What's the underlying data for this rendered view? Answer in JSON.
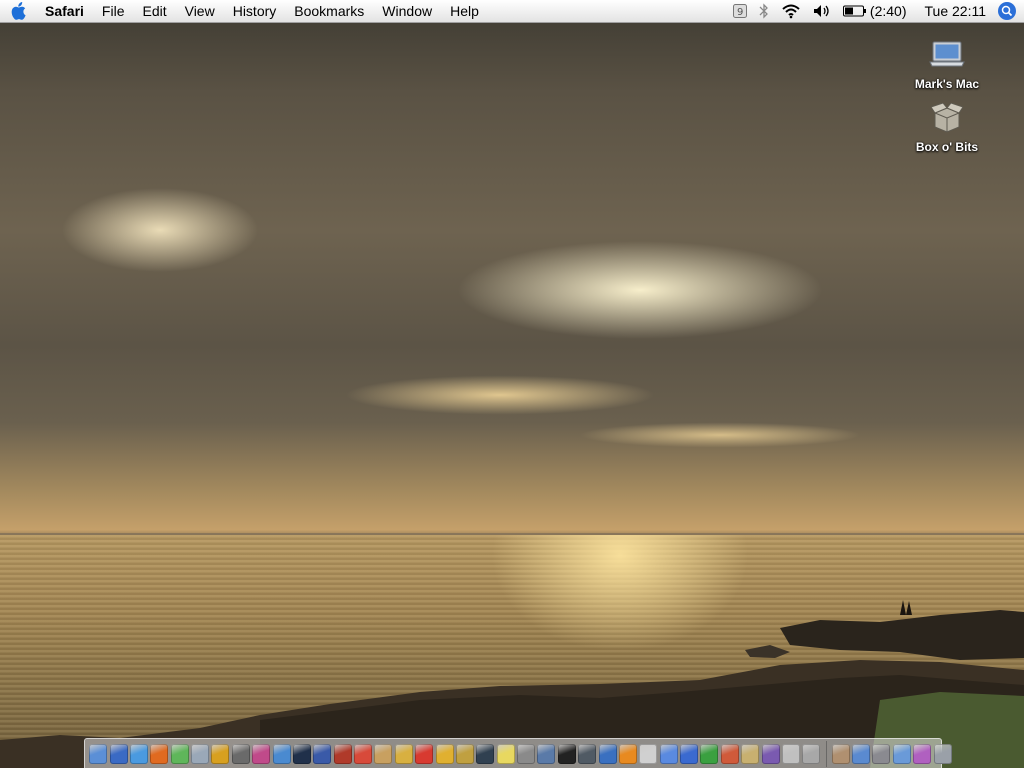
{
  "menubar": {
    "apple_icon": "apple-icon",
    "app_name": "Safari",
    "menus": [
      "File",
      "Edit",
      "View",
      "History",
      "Bookmarks",
      "Window",
      "Help"
    ],
    "status": {
      "battery_time": "(2:40)",
      "clock": "Tue 22:11"
    }
  },
  "desktop": {
    "icons": [
      {
        "label": "Mark's Mac",
        "icon": "laptop-icon"
      },
      {
        "label": "Box o' Bits",
        "icon": "box-icon"
      }
    ]
  },
  "dock": {
    "apps": [
      {
        "icon": "finder-icon",
        "color": "#5b8fd6"
      },
      {
        "icon": "dashboard-icon",
        "color": "#3a6ac4"
      },
      {
        "icon": "safari-icon",
        "color": "#4a9ae0"
      },
      {
        "icon": "firefox-icon",
        "color": "#e06a20"
      },
      {
        "icon": "itunes-icon",
        "color": "#5fb65a"
      },
      {
        "icon": "mail-icon",
        "color": "#9aa8b8"
      },
      {
        "icon": "iphoto-icon",
        "color": "#d8a020"
      },
      {
        "icon": "aperture-icon",
        "color": "#6a6a6a"
      },
      {
        "icon": "postcard-icon",
        "color": "#c04a8a"
      },
      {
        "icon": "preview-icon",
        "color": "#4a8ad0"
      },
      {
        "icon": "camera-icon",
        "color": "#20304a"
      },
      {
        "icon": "imovie-icon",
        "color": "#3a5aa8"
      },
      {
        "icon": "addressbook-icon",
        "color": "#b03a2a"
      },
      {
        "icon": "ical-icon",
        "color": "#d84a3a"
      },
      {
        "icon": "notes-icon",
        "color": "#c8a060"
      },
      {
        "icon": "tools-icon",
        "color": "#d8b040"
      },
      {
        "icon": "lifebuoy-icon",
        "color": "#d83a30"
      },
      {
        "icon": "hand-icon",
        "color": "#e0b030"
      },
      {
        "icon": "keychain-icon",
        "color": "#c0a040"
      },
      {
        "icon": "screen-icon",
        "color": "#304050"
      },
      {
        "icon": "stickies-icon",
        "color": "#e8d860"
      },
      {
        "icon": "calculator-icon",
        "color": "#8a8a8a"
      },
      {
        "icon": "display-icon",
        "color": "#5a7aa8"
      },
      {
        "icon": "terminal-icon",
        "color": "#222222"
      },
      {
        "icon": "activity-icon",
        "color": "#505a64"
      },
      {
        "icon": "network-icon",
        "color": "#3a70c0"
      },
      {
        "icon": "vlc-icon",
        "color": "#e88a20"
      },
      {
        "icon": "textedit-icon",
        "color": "#d0d0d0"
      },
      {
        "icon": "chat-icon",
        "color": "#5a8ae0"
      },
      {
        "icon": "magnet-icon",
        "color": "#3a6ad0"
      },
      {
        "icon": "plant-icon",
        "color": "#3aa040"
      },
      {
        "icon": "brush-icon",
        "color": "#d05a3a"
      },
      {
        "icon": "palette-icon",
        "color": "#c8b070"
      },
      {
        "icon": "colorsync-icon",
        "color": "#7a5ab0"
      },
      {
        "icon": "cards-icon",
        "color": "#c0c0c0"
      },
      {
        "icon": "printer-icon",
        "color": "#a8a8a8"
      }
    ],
    "stacks": [
      {
        "icon": "home-folder-icon",
        "color": "#b09070"
      },
      {
        "icon": "applications-folder-icon",
        "color": "#5a8ad0"
      },
      {
        "icon": "system-preferences-icon",
        "color": "#8a8a90"
      },
      {
        "icon": "documents-folder-icon",
        "color": "#6a9ad8"
      },
      {
        "icon": "apple-folder-icon",
        "color": "#b060c0"
      },
      {
        "icon": "trash-icon",
        "color": "#9aa0a8"
      }
    ]
  }
}
